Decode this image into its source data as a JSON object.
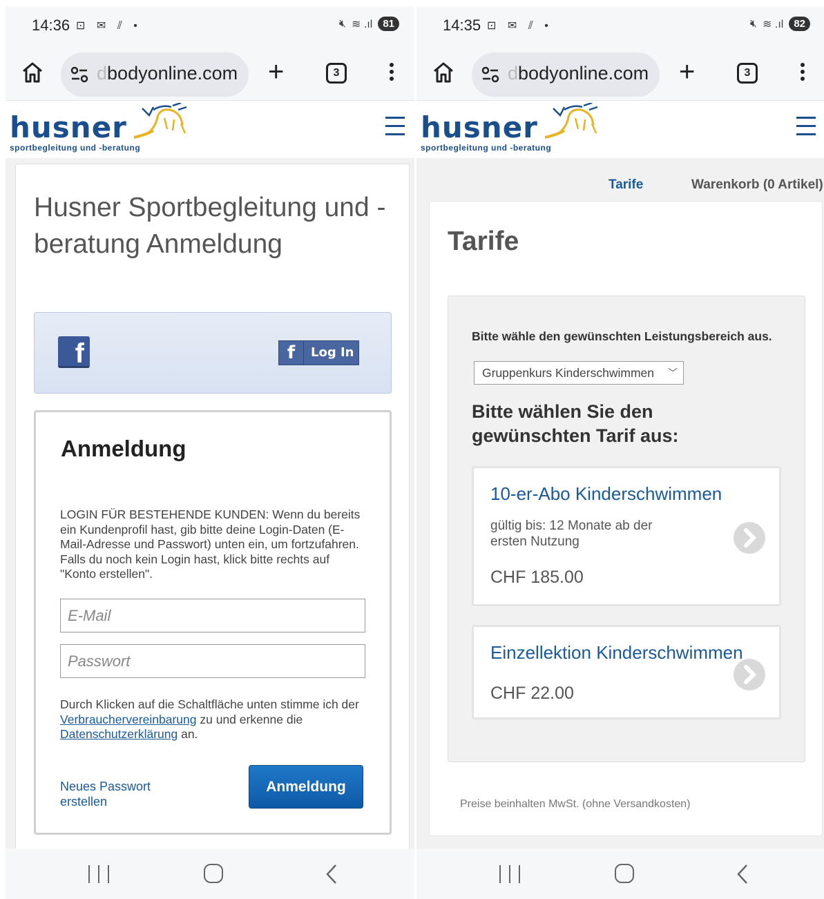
{
  "left": {
    "status": {
      "time": "14:36",
      "battery": "81"
    },
    "browser": {
      "url_faded": "d",
      "url_text": "bodyonline.com",
      "tab_count": "3"
    },
    "logo": {
      "word": "husner",
      "tagline": "sportbegleitung und -beratung"
    },
    "page_title": "Husner Sportbegleitung und -beratung Anmeldung",
    "facebook": {
      "icon_letter": "f",
      "button_letter": "f",
      "button_label": "Log In"
    },
    "login": {
      "heading": "Anmeldung",
      "description": "LOGIN FÜR BESTEHENDE KUNDEN: Wenn du bereits ein Kundenprofil hast, gib bitte deine Login-Daten (E-Mail-Adresse und Passwort) unten ein, um fortzufahren. Falls du noch kein Login hast, klick bitte rechts auf \"Konto erstellen\".",
      "email_placeholder": "E-Mail",
      "password_placeholder": "Passwort",
      "consent_pre": "Durch Klicken auf die Schaltfläche unten stimme ich der ",
      "consent_link1": "Verbrauchervereinbarung",
      "consent_mid": " zu und erkenne die ",
      "consent_link2": "Datenschutzerklärung",
      "consent_post": " an.",
      "forgot_label": "Neues Passwort erstellen",
      "submit_label": "Anmeldung"
    }
  },
  "right": {
    "status": {
      "time": "14:35",
      "battery": "82"
    },
    "browser": {
      "url_faded": "d",
      "url_text": "bodyonline.com",
      "tab_count": "3"
    },
    "logo": {
      "word": "husner",
      "tagline": "sportbegleitung und -beratung"
    },
    "nav": {
      "tarife": "Tarife",
      "cart": "Warenkorb (0 Artikel)"
    },
    "title": "Tarife",
    "select_label": "Bitte wähle den gewünschten Leistungsbereich aus.",
    "select_value": "Gruppenkurs Kinderschwimmen",
    "choose_heading": "Bitte wählen Sie den gewünschten Tarif aus:",
    "offers": [
      {
        "name": "10-er-Abo Kinderschwimmen",
        "valid": "gültig bis: 12 Monate ab der ersten Nutzung",
        "price": "CHF 185.00"
      },
      {
        "name": "Einzellektion Kinderschwimmen",
        "price": "CHF 22.00"
      }
    ],
    "footnote": "Preise beinhalten MwSt. (ohne Versandkosten)"
  },
  "colors": {
    "brand_blue": "#1a4e8c",
    "link_blue": "#1a5a9a",
    "button_blue": "#1f78c8",
    "facebook_blue": "#3b5998"
  }
}
